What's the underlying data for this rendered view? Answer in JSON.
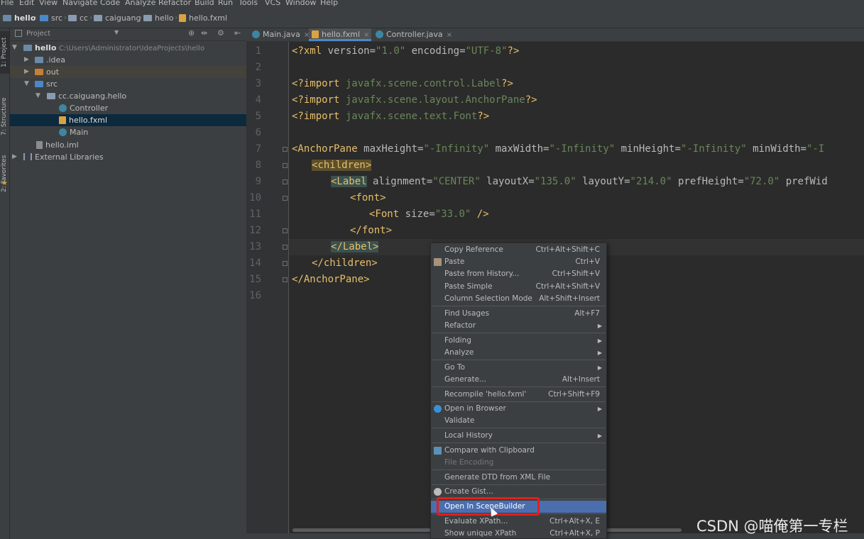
{
  "menubar": [
    "File",
    "Edit",
    "View",
    "Navigate",
    "Code",
    "Analyze",
    "Refactor",
    "Build",
    "Run",
    "Tools",
    "VCS",
    "Window",
    "Help"
  ],
  "breadcrumb": [
    "hello",
    "src",
    "cc",
    "caiguang",
    "hello",
    "hello.fxml"
  ],
  "left_stripe": {
    "project": "1: Project",
    "structure": "7: Structure",
    "favorites": "2: Favorites"
  },
  "project_panel": {
    "title": "Project",
    "tree": [
      {
        "name": "hello",
        "path": "C:\\Users\\Administrator\\IdeaProjects\\hello"
      },
      {
        "name": ".idea"
      },
      {
        "name": "out"
      },
      {
        "name": "src"
      },
      {
        "name": "cc.caiguang.hello"
      },
      {
        "name": "Controller"
      },
      {
        "name": "hello.fxml"
      },
      {
        "name": "Main"
      },
      {
        "name": "hello.iml"
      },
      {
        "name": "External Libraries"
      }
    ]
  },
  "tabs": [
    {
      "label": "Main.java"
    },
    {
      "label": "hello.fxml"
    },
    {
      "label": "Controller.java"
    }
  ],
  "editor": {
    "line_numbers": [
      "1",
      "2",
      "3",
      "4",
      "5",
      "6",
      "7",
      "8",
      "9",
      "10",
      "11",
      "12",
      "13",
      "14",
      "15",
      "16"
    ],
    "l1": {
      "a": "<?xml ",
      "b": "version",
      "c": "=",
      "d": "\"1.0\"",
      "e": " ",
      "f": "encoding",
      "g": "=",
      "h": "\"UTF-8\"",
      "i": "?>"
    },
    "l3": {
      "a": "<?import ",
      "b": "javafx.scene.control.Label",
      "c": "?>"
    },
    "l4": {
      "a": "<?import ",
      "b": "javafx.scene.layout.AnchorPane",
      "c": "?>"
    },
    "l5": {
      "a": "<?import ",
      "b": "javafx.scene.text.Font",
      "c": "?>"
    },
    "l7": {
      "tag": "<AnchorPane",
      "a1": " maxHeight",
      "v1": "\"-Infinity\"",
      "a2": " maxWidth",
      "v2": "\"-Infinity\"",
      "a3": " minHeight",
      "v3": "\"-Infinity\"",
      "a4": " minWidth",
      "v4": "\"-I"
    },
    "l8": {
      "tag": "<children>"
    },
    "l9": {
      "tag": "<Label",
      "a1": " alignment",
      "v1": "\"CENTER\"",
      "a2": " layoutX",
      "v2": "\"135.0\"",
      "a3": " layoutY",
      "v3": "\"214.0\"",
      "a4": " prefHeight",
      "v4": "\"72.0\"",
      "a5": " prefWid"
    },
    "l10": {
      "tag": "<font>"
    },
    "l11": {
      "tag": "<Font",
      "a1": " size",
      "v1": "\"33.0\"",
      "end": " />"
    },
    "l12": {
      "tag": "</font>"
    },
    "l13": {
      "tag": "</Label>"
    },
    "l14": {
      "tag": "</children>"
    },
    "l15": {
      "tag": "</AnchorPane>"
    },
    "eq": "="
  },
  "context_menu": [
    {
      "label": "Copy Reference",
      "shortcut": "Ctrl+Alt+Shift+C"
    },
    {
      "label": "Paste",
      "shortcut": "Ctrl+V"
    },
    {
      "label": "Paste from History...",
      "shortcut": "Ctrl+Shift+V"
    },
    {
      "label": "Paste Simple",
      "shortcut": "Ctrl+Alt+Shift+V"
    },
    {
      "label": "Column Selection Mode",
      "shortcut": "Alt+Shift+Insert"
    },
    {
      "label": "Find Usages",
      "shortcut": "Alt+F7"
    },
    {
      "label": "Refactor",
      "shortcut": ""
    },
    {
      "label": "Folding",
      "shortcut": ""
    },
    {
      "label": "Analyze",
      "shortcut": ""
    },
    {
      "label": "Go To",
      "shortcut": ""
    },
    {
      "label": "Generate...",
      "shortcut": "Alt+Insert"
    },
    {
      "label": "Recompile 'hello.fxml'",
      "shortcut": "Ctrl+Shift+F9"
    },
    {
      "label": "Open in Browser",
      "shortcut": ""
    },
    {
      "label": "Validate",
      "shortcut": ""
    },
    {
      "label": "Local History",
      "shortcut": ""
    },
    {
      "label": "Compare with Clipboard",
      "shortcut": ""
    },
    {
      "label": "File Encoding",
      "shortcut": ""
    },
    {
      "label": "Generate DTD from XML File",
      "shortcut": ""
    },
    {
      "label": "Create Gist...",
      "shortcut": ""
    },
    {
      "label": "Open In SceneBuilder",
      "shortcut": ""
    },
    {
      "label": "Evaluate XPath...",
      "shortcut": "Ctrl+Alt+X, E"
    },
    {
      "label": "Show unique XPath",
      "shortcut": "Ctrl+Alt+X, P"
    }
  ],
  "watermark": "CSDN @喵俺第一专栏",
  "colors": {
    "accent": "#4b6eaf",
    "highlight_box": "#e0201b",
    "editor_bg": "#2b2b2b",
    "panel_bg": "#3c3f41"
  }
}
